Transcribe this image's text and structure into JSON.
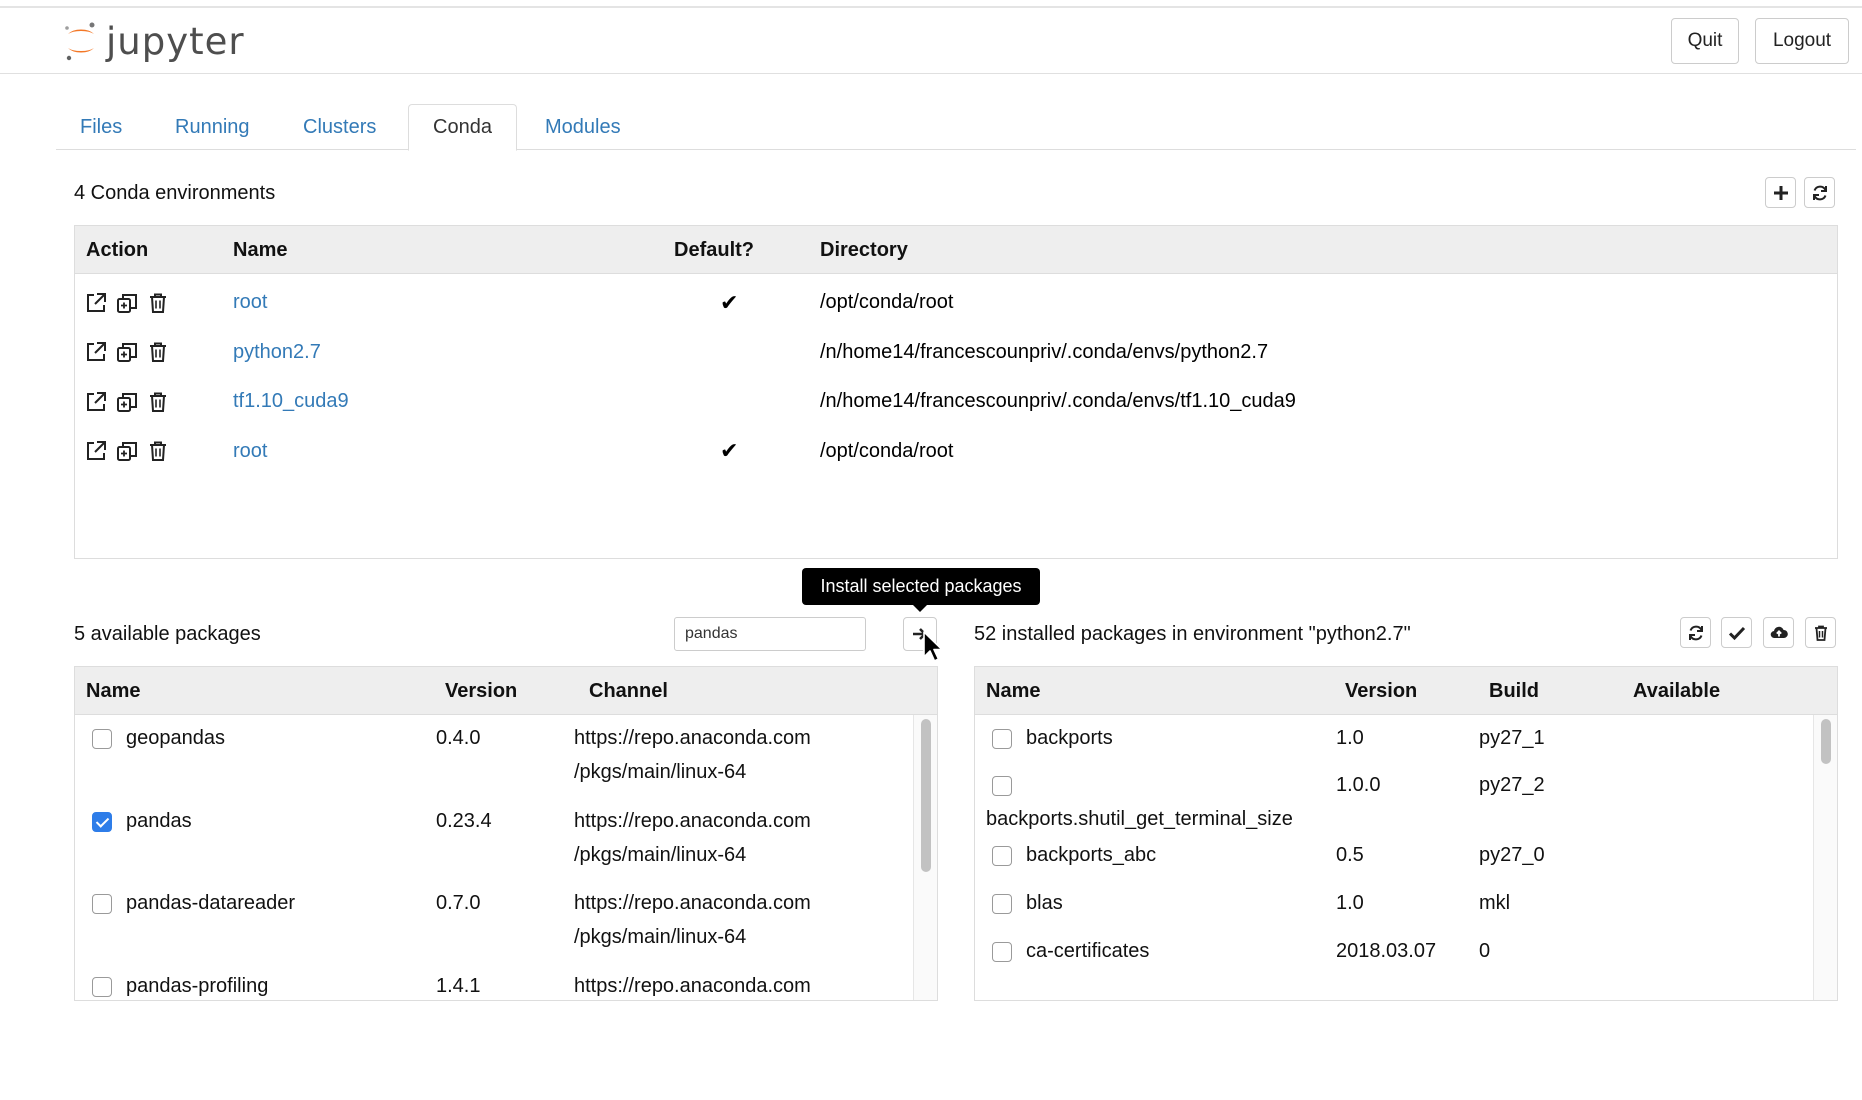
{
  "header": {
    "logo_text": "jupyter",
    "quit_label": "Quit",
    "logout_label": "Logout"
  },
  "tabs": [
    {
      "label": "Files",
      "active": false
    },
    {
      "label": "Running",
      "active": false
    },
    {
      "label": "Clusters",
      "active": false
    },
    {
      "label": "Conda",
      "active": true
    },
    {
      "label": "Modules",
      "active": false
    }
  ],
  "environments": {
    "count_label": "4 Conda environments",
    "columns": [
      "Action",
      "Name",
      "Default?",
      "Directory"
    ],
    "rows": [
      {
        "name": "root",
        "default": true,
        "default_mark": "✔",
        "directory": "/opt/conda/root"
      },
      {
        "name": "python2.7",
        "default": false,
        "default_mark": "",
        "directory": "/n/home14/francescounpriv/.conda/envs/python2.7"
      },
      {
        "name": "tf1.10_cuda9",
        "default": false,
        "default_mark": "",
        "directory": "/n/home14/francescounpriv/.conda/envs/tf1.10_cuda9"
      },
      {
        "name": "root",
        "default": true,
        "default_mark": "✔",
        "directory": "/opt/conda/root"
      }
    ],
    "toolbar_icons": [
      "plus-icon",
      "refresh-icon"
    ],
    "action_icons": [
      "external-link-icon",
      "clone-icon",
      "trash-icon"
    ]
  },
  "available": {
    "count_label": "5 available packages",
    "search_value": "pandas",
    "search_placeholder": "",
    "tooltip": "Install selected packages",
    "columns": [
      "Name",
      "Version",
      "Channel"
    ],
    "rows": [
      {
        "name": "geopandas",
        "version": "0.4.0",
        "channel_line1": "https://repo.anaconda.com",
        "channel_line2": "/pkgs/main/linux-64",
        "checked": false
      },
      {
        "name": "pandas",
        "version": "0.23.4",
        "channel_line1": "https://repo.anaconda.com",
        "channel_line2": "/pkgs/main/linux-64",
        "checked": true
      },
      {
        "name": "pandas-datareader",
        "version": "0.7.0",
        "channel_line1": "https://repo.anaconda.com",
        "channel_line2": "/pkgs/main/linux-64",
        "checked": false
      },
      {
        "name": "pandas-profiling",
        "version": "1.4.1",
        "channel_line1": "https://repo.anaconda.com",
        "channel_line2": "",
        "checked": false
      }
    ],
    "scroll_position": 0.0,
    "scroll_visible_fraction": 0.55
  },
  "installed": {
    "count_label": "52 installed packages in environment \"python2.7\"",
    "columns": [
      "Name",
      "Version",
      "Build",
      "Available"
    ],
    "toolbar_icons": [
      "refresh-icon",
      "check-icon",
      "cloud-upload-icon",
      "trash-icon"
    ],
    "rows": [
      {
        "name": "backports",
        "version": "1.0",
        "build": "py27_1",
        "available": "",
        "checked": false
      },
      {
        "name": "backports.shutil_get_terminal_size",
        "version": "1.0.0",
        "build": "py27_2",
        "available": "",
        "checked": false
      },
      {
        "name": "backports_abc",
        "version": "0.5",
        "build": "py27_0",
        "available": "",
        "checked": false
      },
      {
        "name": "blas",
        "version": "1.0",
        "build": "mkl",
        "available": "",
        "checked": false
      },
      {
        "name": "ca-certificates",
        "version": "2018.03.07",
        "build": "0",
        "available": "",
        "checked": false
      }
    ],
    "scroll_position": 0.0,
    "scroll_visible_fraction": 0.1
  },
  "colors": {
    "link": "#337ab7",
    "logo_orange": "#f37726",
    "checkbox_checked": "#2e7de9"
  }
}
